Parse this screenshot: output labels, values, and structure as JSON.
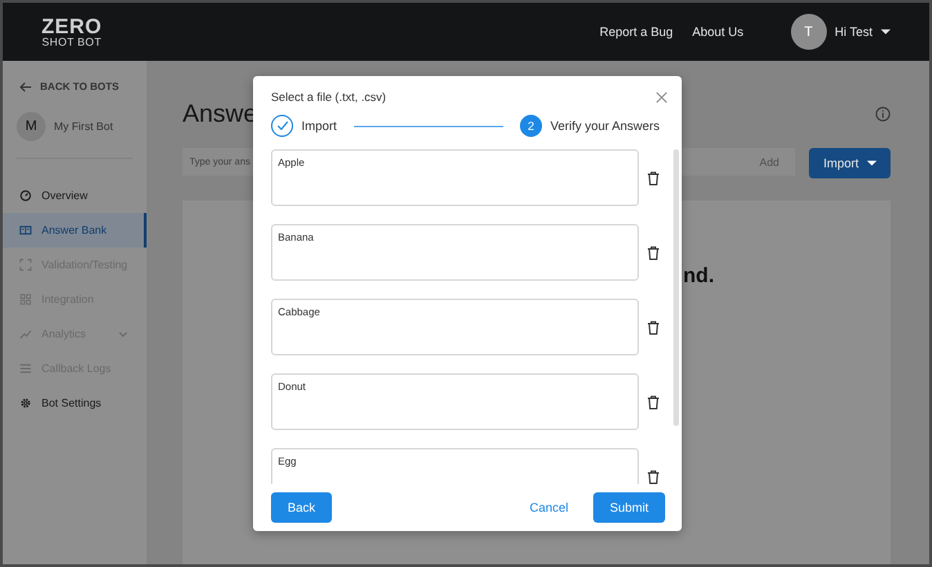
{
  "header": {
    "logo": {
      "line1": "ZERO",
      "line2": "SHOT BOT"
    },
    "links": [
      "Report a Bug",
      "About Us"
    ],
    "user": {
      "initial": "T",
      "greeting": "Hi Test"
    }
  },
  "sidebar": {
    "back": "BACK TO BOTS",
    "bot": {
      "initial": "M",
      "name": "My First Bot"
    },
    "items": [
      {
        "label": "Overview",
        "selected": false,
        "disabled": false
      },
      {
        "label": "Answer Bank",
        "selected": true,
        "disabled": false
      },
      {
        "label": "Validation/Testing",
        "selected": false,
        "disabled": true
      },
      {
        "label": "Integration",
        "selected": false,
        "disabled": true
      },
      {
        "label": "Analytics",
        "selected": false,
        "disabled": true,
        "expandable": true
      },
      {
        "label": "Callback Logs",
        "selected": false,
        "disabled": true
      },
      {
        "label": "Bot Settings",
        "selected": false,
        "disabled": false
      }
    ]
  },
  "main": {
    "title": "Answe",
    "input": {
      "placeholder": "Type your ans"
    },
    "add": "Add",
    "import": "Import",
    "empty_text": "nd."
  },
  "dialog": {
    "title": "Select a file (.txt, .csv)",
    "steps": [
      {
        "label": "Import",
        "done": true
      },
      {
        "number": "2",
        "label": "Verify your Answers",
        "done": false
      }
    ],
    "answers": [
      "Apple",
      "Banana",
      "Cabbage",
      "Donut",
      "Egg"
    ],
    "back": "Back",
    "cancel": "Cancel",
    "submit": "Submit"
  }
}
